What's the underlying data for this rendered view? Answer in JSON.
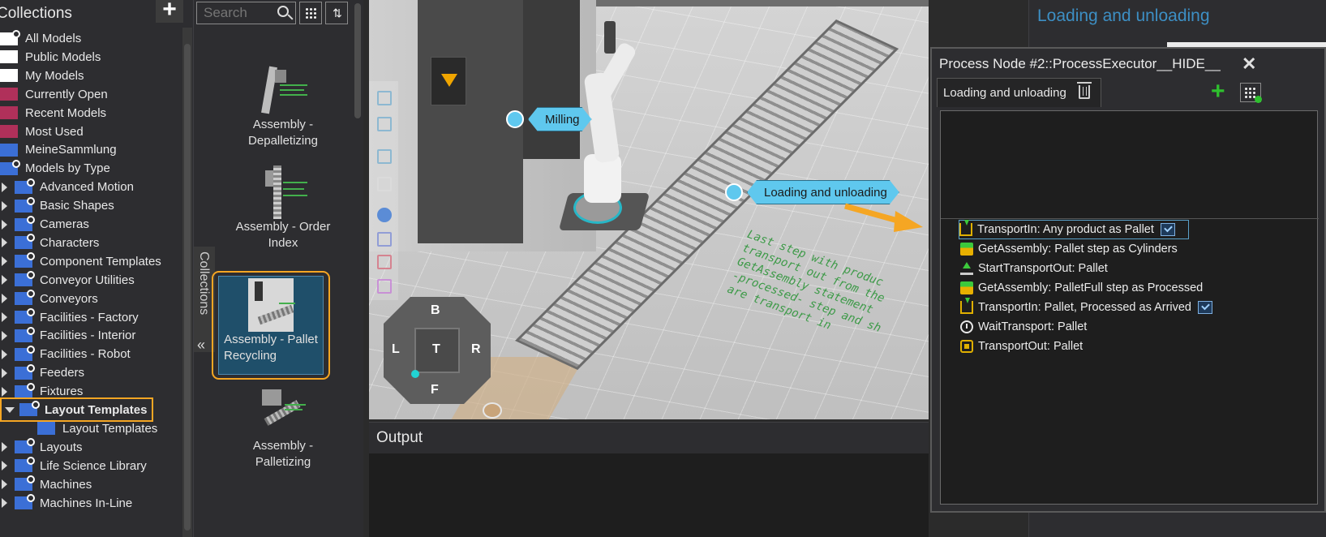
{
  "tree": {
    "title": "Collections",
    "items": [
      {
        "label": "All Models",
        "color": "white",
        "gear": true,
        "arrow": "none",
        "indent": 0
      },
      {
        "label": "Public Models",
        "color": "white",
        "gear": false,
        "arrow": "none",
        "indent": 0
      },
      {
        "label": "My Models",
        "color": "white",
        "gear": false,
        "arrow": "none",
        "indent": 0
      },
      {
        "label": "Currently Open",
        "color": "red",
        "gear": false,
        "arrow": "none",
        "indent": 0
      },
      {
        "label": "Recent Models",
        "color": "red",
        "gear": false,
        "arrow": "none",
        "indent": 0
      },
      {
        "label": "Most Used",
        "color": "red",
        "gear": false,
        "arrow": "none",
        "indent": 0
      },
      {
        "label": "MeineSammlung",
        "color": "blue",
        "gear": false,
        "arrow": "none",
        "indent": 0
      },
      {
        "label": "Models by Type",
        "color": "blue",
        "gear": true,
        "arrow": "none",
        "indent": 0
      },
      {
        "label": "Advanced Motion",
        "color": "blue",
        "gear": true,
        "arrow": "closed",
        "indent": 1
      },
      {
        "label": "Basic Shapes",
        "color": "blue",
        "gear": true,
        "arrow": "closed",
        "indent": 1
      },
      {
        "label": "Cameras",
        "color": "blue",
        "gear": true,
        "arrow": "closed",
        "indent": 1
      },
      {
        "label": "Characters",
        "color": "blue",
        "gear": true,
        "arrow": "closed",
        "indent": 1
      },
      {
        "label": "Component Templates",
        "color": "blue",
        "gear": true,
        "arrow": "closed",
        "indent": 1
      },
      {
        "label": "Conveyor Utilities",
        "color": "blue",
        "gear": true,
        "arrow": "closed",
        "indent": 1
      },
      {
        "label": "Conveyors",
        "color": "blue",
        "gear": true,
        "arrow": "closed",
        "indent": 1
      },
      {
        "label": "Facilities - Factory",
        "color": "blue",
        "gear": true,
        "arrow": "closed",
        "indent": 1
      },
      {
        "label": "Facilities - Interior",
        "color": "blue",
        "gear": true,
        "arrow": "closed",
        "indent": 1
      },
      {
        "label": "Facilities - Robot",
        "color": "blue",
        "gear": true,
        "arrow": "closed",
        "indent": 1
      },
      {
        "label": "Feeders",
        "color": "blue",
        "gear": true,
        "arrow": "closed",
        "indent": 1
      },
      {
        "label": "Fixtures",
        "color": "blue",
        "gear": true,
        "arrow": "closed",
        "indent": 1
      },
      {
        "label": "Layout Templates",
        "color": "blue",
        "gear": true,
        "arrow": "open",
        "indent": 1,
        "highlight": true
      },
      {
        "label": "Layout Templates",
        "color": "blue",
        "gear": false,
        "arrow": "none",
        "indent": 2
      },
      {
        "label": "Layouts",
        "color": "blue",
        "gear": true,
        "arrow": "closed",
        "indent": 1
      },
      {
        "label": "Life Science Library",
        "color": "blue",
        "gear": true,
        "arrow": "closed",
        "indent": 1
      },
      {
        "label": "Machines",
        "color": "blue",
        "gear": true,
        "arrow": "closed",
        "indent": 1
      },
      {
        "label": "Machines In-Line",
        "color": "blue",
        "gear": true,
        "arrow": "closed",
        "indent": 1
      }
    ]
  },
  "search": {
    "placeholder": "Search"
  },
  "side_tab": {
    "label": "Collections"
  },
  "models": [
    {
      "line1": "Assembly -",
      "line2": "Depalletizing"
    },
    {
      "line1": "Assembly - Order",
      "line2": "Index"
    },
    {
      "line1": "Assembly - Pallet",
      "line2": "Recycling",
      "selected": true
    },
    {
      "line1": "Assembly -",
      "line2": "Palletizing"
    }
  ],
  "viewport": {
    "labels": {
      "milling": "Milling",
      "loading": "Loading and unloading"
    },
    "floor_text": "Last step with produc\ntransport out from the\nGetAssembly statement\n-processed- step and sh\nare transport in",
    "navcube": {
      "top": "B",
      "left": "L",
      "center": "T",
      "right": "R",
      "bottom": "F"
    }
  },
  "output": {
    "title": "Output"
  },
  "right_panel": {
    "title": "Loading and unloading"
  },
  "process_window": {
    "title": "Process Node #2::ProcessExecutor__HIDE__",
    "close": "✕",
    "tab_label": "Loading and unloading",
    "add": "+",
    "statements": [
      {
        "text": "TransportIn: Any product as Pallet",
        "icon": "transport-in-icon",
        "check": true,
        "selected": true
      },
      {
        "text": "GetAssembly: Pallet step as Cylinders",
        "icon": "get-assembly-icon",
        "check": false
      },
      {
        "text": "StartTransportOut: Pallet",
        "icon": "start-transport-out-icon",
        "check": false
      },
      {
        "text": "GetAssembly: PalletFull step as Processed",
        "icon": "get-assembly-icon",
        "check": false
      },
      {
        "text": "TransportIn: Pallet, Processed as Arrived",
        "icon": "transport-in-icon",
        "check": true
      },
      {
        "text": "WaitTransport: Pallet",
        "icon": "wait-transport-icon",
        "check": false
      },
      {
        "text": "TransportOut: Pallet",
        "icon": "transport-out-icon",
        "check": false
      }
    ]
  },
  "colors": {
    "accent": "#f5a623",
    "label_blue": "#5fc8ee",
    "title_blue": "#3d8fc4",
    "add_green": "#2ec02e"
  }
}
